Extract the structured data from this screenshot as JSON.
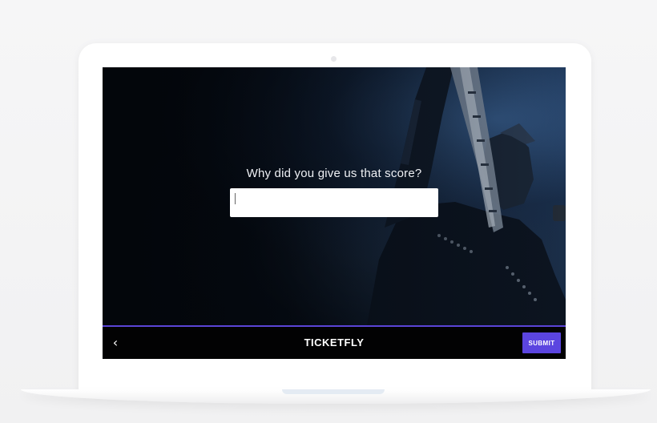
{
  "survey": {
    "question": "Why did you give us that score?",
    "answer_value": "",
    "answer_placeholder": ""
  },
  "footer": {
    "back_icon": "chevron-left-icon",
    "back_glyph": "‹",
    "brand": "TICKETFLY",
    "submit_label": "SUBMIT"
  },
  "colors": {
    "accent": "#5b45e0",
    "footer_background": "#020203",
    "screen_background": "#05080d"
  }
}
